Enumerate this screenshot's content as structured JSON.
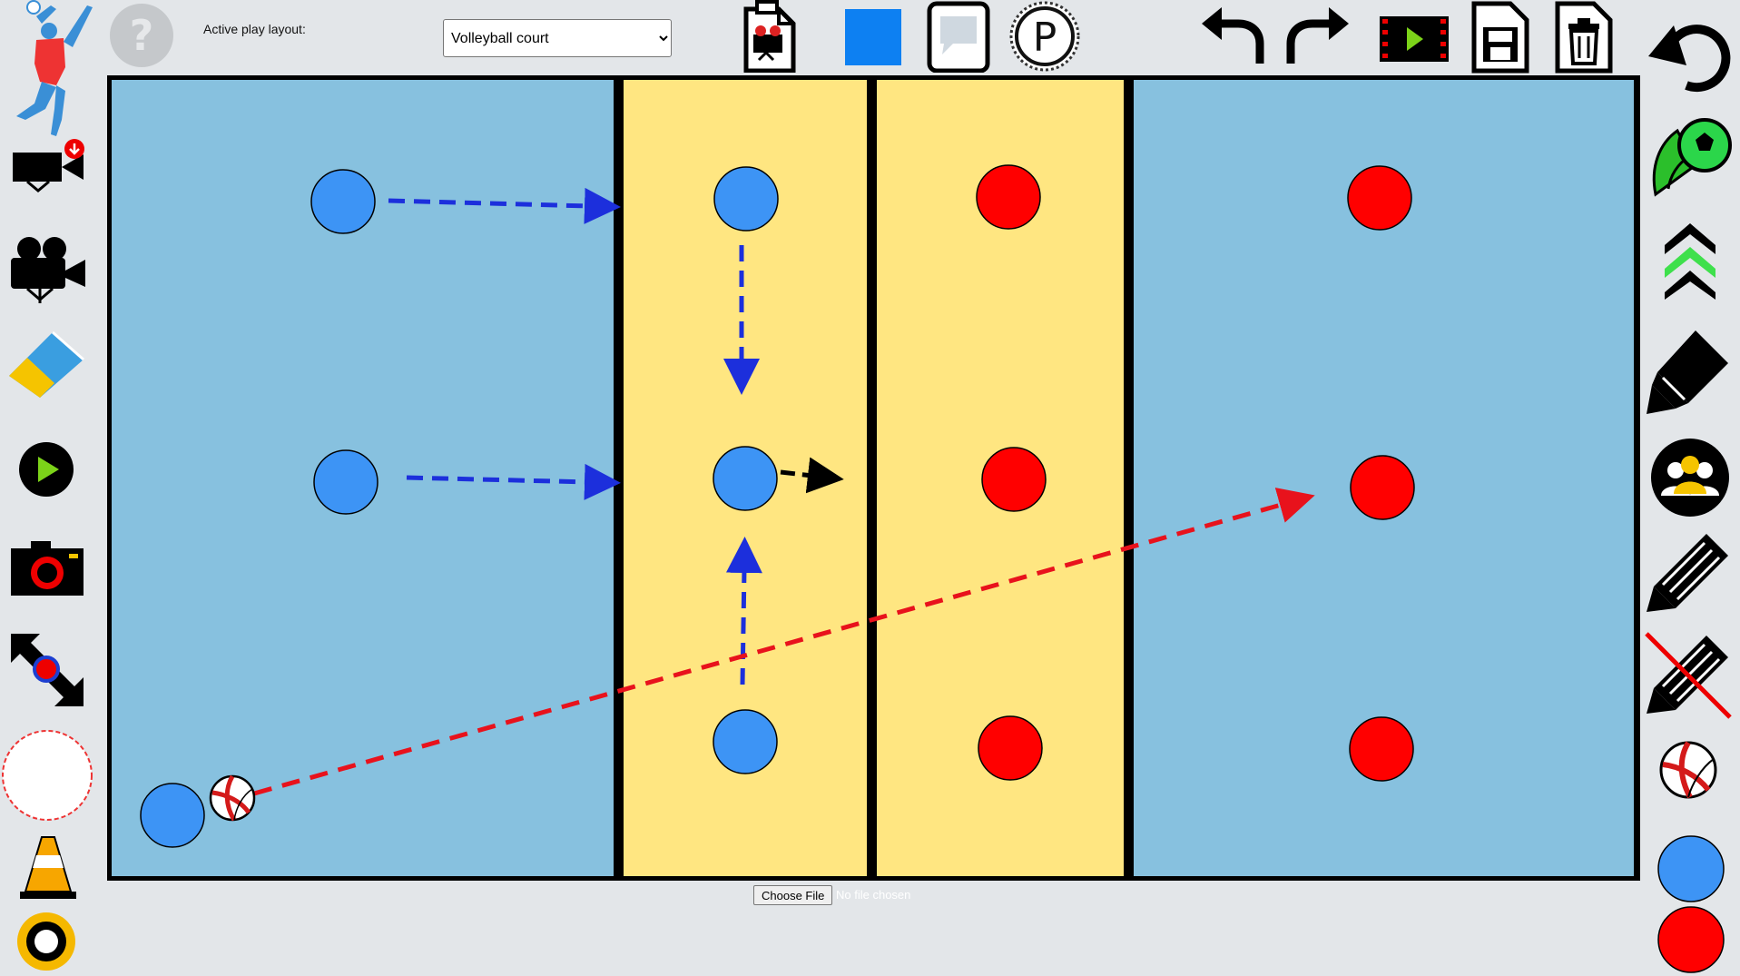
{
  "app": {
    "layout_label": "Active play layout:",
    "layout_selected": "Volleyball court",
    "file_button": "Choose File",
    "file_status": "No file chosen"
  },
  "colors": {
    "back_zone": "#87c1df",
    "front_zone": "#ffe681",
    "team_blue": "#3d94f5",
    "team_red": "#ff0000",
    "arrow_blue": "#1c2fdc",
    "arrow_red": "#e8121c",
    "arrow_black": "#000000",
    "swatch_blue": "#0d80f2",
    "panel_bg": "#e3e6e9"
  },
  "toolbar_top": [
    "help-icon",
    "clear-screenshot-icon",
    "color-swatch",
    "speech-bubble-icon",
    "parking-icon",
    "undo-icon",
    "redo-icon",
    "play-animation-icon",
    "save-icon",
    "delete-icon"
  ],
  "toolbar_left": [
    "volleyball-player-logo",
    "record-video-icon",
    "camera-film-icon",
    "eraser-icon",
    "play-icon",
    "photo-camera-icon",
    "resize-icon",
    "circle-zone-icon",
    "cone-icon",
    "ring-icon"
  ],
  "toolbar_right": [
    "reset-icon",
    "ball-shot-icon",
    "chevrons-up-icon",
    "marker-icon",
    "team-icon",
    "pencil-icon",
    "pencil-off-icon",
    "volleyball-icon",
    "blue-player-icon",
    "red-player-icon"
  ],
  "court": {
    "zones": [
      "back-court-left",
      "front-court-left",
      "front-court-right",
      "back-court-right"
    ],
    "players": [
      {
        "team": "blue",
        "role": "back-left-top"
      },
      {
        "team": "blue",
        "role": "back-left-mid"
      },
      {
        "team": "blue",
        "role": "server"
      },
      {
        "team": "blue",
        "role": "front-top"
      },
      {
        "team": "blue",
        "role": "front-mid"
      },
      {
        "team": "blue",
        "role": "front-bottom"
      },
      {
        "team": "red",
        "role": "front-top"
      },
      {
        "team": "red",
        "role": "front-mid"
      },
      {
        "team": "red",
        "role": "front-bottom"
      },
      {
        "team": "red",
        "role": "back-top"
      },
      {
        "team": "red",
        "role": "back-mid"
      },
      {
        "team": "red",
        "role": "back-bottom"
      }
    ],
    "arrows": [
      {
        "color": "blue",
        "from": "back-left-top",
        "to": "front-zone"
      },
      {
        "color": "blue",
        "from": "back-left-mid",
        "to": "front-zone"
      },
      {
        "color": "blue",
        "from": "front-top",
        "to": "front-mid"
      },
      {
        "color": "blue",
        "from": "front-bottom",
        "to": "front-mid"
      },
      {
        "color": "black",
        "from": "front-mid",
        "to": "net"
      },
      {
        "color": "red",
        "from": "serve-ball",
        "to": "red-back-mid"
      }
    ]
  }
}
